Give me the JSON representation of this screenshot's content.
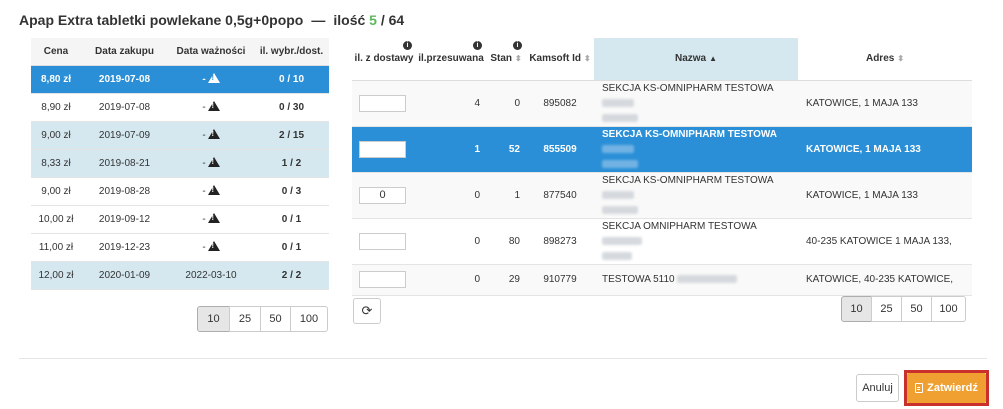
{
  "header": {
    "product": "Apap Extra tabletki powlekane 0,5g+0popo",
    "dash": "—",
    "qty_label": "ilość",
    "qty_selected": "5",
    "qty_separator": "/",
    "qty_total": "64"
  },
  "left_table": {
    "columns": [
      "Cena",
      "Data zakupu",
      "Data ważności",
      "il. wybr./dost."
    ],
    "rows": [
      {
        "price": "8,80 zł",
        "purchase": "2019-07-08",
        "expiry": "-",
        "qty": "0 / 10"
      },
      {
        "price": "8,90 zł",
        "purchase": "2019-07-08",
        "expiry": "-",
        "qty": "0 / 30"
      },
      {
        "price": "9,00 zł",
        "purchase": "2019-07-09",
        "expiry": "-",
        "qty": "2 / 15"
      },
      {
        "price": "8,33 zł",
        "purchase": "2019-08-21",
        "expiry": "-",
        "qty": "1 / 2"
      },
      {
        "price": "9,00 zł",
        "purchase": "2019-08-28",
        "expiry": "-",
        "qty": "0 / 3"
      },
      {
        "price": "10,00 zł",
        "purchase": "2019-09-12",
        "expiry": "-",
        "qty": "0 / 1"
      },
      {
        "price": "11,00 zł",
        "purchase": "2019-12-23",
        "expiry": "-",
        "qty": "0 / 1"
      },
      {
        "price": "12,00 zł",
        "purchase": "2020-01-09",
        "expiry": "2022-03-10",
        "qty": "2 / 2"
      }
    ],
    "page_sizes": [
      "10",
      "25",
      "50",
      "100"
    ],
    "active_page_size": "10"
  },
  "right_table": {
    "columns": {
      "delivery": "il. z dostawy",
      "shifted": "il.przesuwana",
      "stock": "Stan",
      "kamsoft": "Kamsoft Id",
      "name": "Nazwa",
      "address": "Adres"
    },
    "rows": [
      {
        "input": "",
        "shifted": "4",
        "stock": "0",
        "id": "895082",
        "name": "SEKCJA KS-OMNIPHARM TESTOWA",
        "address": "KATOWICE, 1 MAJA 133"
      },
      {
        "input": "",
        "shifted": "1",
        "stock": "52",
        "id": "855509",
        "name": "SEKCJA KS-OMNIPHARM TESTOWA",
        "address": "KATOWICE, 1 MAJA 133"
      },
      {
        "input": "0",
        "shifted": "0",
        "stock": "1",
        "id": "877540",
        "name": "SEKCJA KS-OMNIPHARM TESTOWA",
        "address": "KATOWICE, 1 MAJA 133"
      },
      {
        "input": "",
        "shifted": "0",
        "stock": "80",
        "id": "898273",
        "name": "SEKCJA OMNIPHARM TESTOWA",
        "address": "40-235 KATOWICE 1 MAJA 133,"
      },
      {
        "input": "",
        "shifted": "0",
        "stock": "29",
        "id": "910779",
        "name": "TESTOWA 5110",
        "address": "KATOWICE, 40-235 KATOWICE,"
      }
    ],
    "page_sizes": [
      "10",
      "25",
      "50",
      "100"
    ],
    "active_page_size": "10"
  },
  "footer": {
    "cancel": "Anuluj",
    "confirm": "Zatwierdź"
  },
  "colors": {
    "selected_row": "#2a8fd6",
    "light_row": "#d5e8f0",
    "confirm_button": "#f0a030",
    "highlight_frame": "#c9302c",
    "qty_selected": "#5cb85c"
  }
}
